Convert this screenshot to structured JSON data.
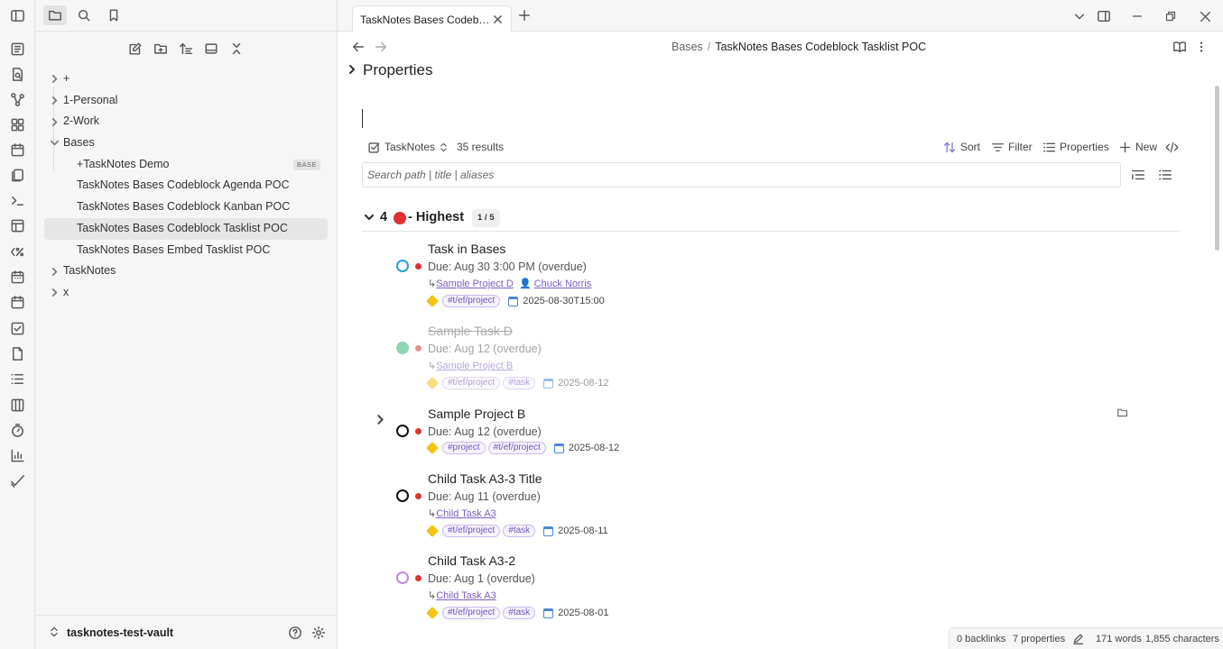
{
  "ribbon": {
    "icons": [
      "sidebar-toggle-icon",
      "dashboard-icon",
      "file-search-icon",
      "graph-icon",
      "blocks-icon",
      "calendar-icon",
      "pages-icon",
      "terminal-icon",
      "layout-icon",
      "percent-code-icon",
      "calendar-grid-icon",
      "calendar-day-icon",
      "checkbox-icon",
      "document-icon",
      "list-icon",
      "kanban-icon",
      "timer-icon",
      "chart-icon",
      "checkmark-icon"
    ]
  },
  "sidebar": {
    "tree": [
      {
        "label": "+",
        "type": "folder"
      },
      {
        "label": "1-Personal",
        "type": "folder"
      },
      {
        "label": "2-Work",
        "type": "folder"
      },
      {
        "label": "Bases",
        "type": "folder-open"
      },
      {
        "label": "+TaskNotes Demo",
        "type": "file",
        "badge": "BASE"
      },
      {
        "label": "TaskNotes Bases Codeblock Agenda POC",
        "type": "file"
      },
      {
        "label": "TaskNotes Bases Codeblock Kanban POC",
        "type": "file"
      },
      {
        "label": "TaskNotes Bases Codeblock Tasklist POC",
        "type": "file",
        "selected": true
      },
      {
        "label": "TaskNotes Bases Embed Tasklist POC",
        "type": "file"
      },
      {
        "label": "TaskNotes",
        "type": "folder"
      },
      {
        "label": "x",
        "type": "folder"
      }
    ],
    "vault_name": "tasknotes-test-vault"
  },
  "tab": {
    "title": "TaskNotes Bases Codeblock Tasklist POC"
  },
  "breadcrumb": {
    "parent": "Bases",
    "separator": "/",
    "current": "TaskNotes Bases Codeblock Tasklist POC"
  },
  "properties_heading": "Properties",
  "base": {
    "view_name": "TaskNotes",
    "results": "35 results",
    "sort_label": "Sort",
    "filter_label": "Filter",
    "properties_label": "Properties",
    "new_label": "New",
    "search_placeholder": "Search path | title | aliases"
  },
  "group": {
    "prefix": "4",
    "label": "- Highest",
    "count": "1 / 5"
  },
  "tasks": [
    {
      "title": "Task in Bases",
      "due": "Due: Aug 30 3:00 PM (overdue)",
      "project": "Sample Project D",
      "person": "Chuck Norris",
      "tags": [
        "#t/ef/project"
      ],
      "date": "2025-08-30T15:00",
      "status_color": "#2a9fd6",
      "completed": false
    },
    {
      "title": "Sample Task D",
      "due": "Due: Aug 12 (overdue)",
      "project": "Sample Project B",
      "tags": [
        "#t/ef/project",
        "#task"
      ],
      "date": "2025-08-12",
      "status_color": "#2eb872",
      "completed": true
    },
    {
      "title": "Sample Project B",
      "due": "Due: Aug 12 (overdue)",
      "tags": [
        "#project",
        "#t/ef/project"
      ],
      "date": "2025-08-12",
      "status_color": "#111111",
      "completed": false
    },
    {
      "title": "Child Task A3-3 Title",
      "due": "Due: Aug 11 (overdue)",
      "project": "Child Task A3",
      "tags": [
        "#t/ef/project",
        "#task"
      ],
      "date": "2025-08-11",
      "status_color": "#111111",
      "completed": false
    },
    {
      "title": "Child Task A3-2",
      "due": "Due: Aug 1 (overdue)",
      "project": "Child Task A3",
      "tags": [
        "#t/ef/project",
        "#task"
      ],
      "date": "2025-08-01",
      "status_color": "#c08ad6",
      "completed": false
    }
  ],
  "statusbar": {
    "backlinks": "0 backlinks",
    "properties": "7 properties",
    "words": "171 words",
    "characters": "1,855 characters"
  },
  "colors": {
    "accent": "#7a7ad6",
    "priority_high": "#e03131",
    "link": "#7c5cc4"
  }
}
